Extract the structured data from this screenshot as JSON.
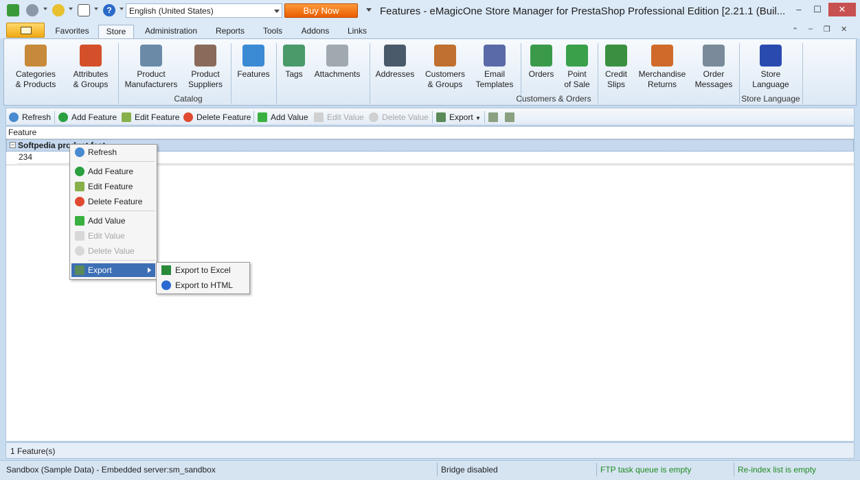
{
  "window": {
    "title": "Features - eMagicOne Store Manager for PrestaShop Professional Edition [2.21.1 (Buil...",
    "language_selected": "English (United States)",
    "buy_now": "Buy Now",
    "minimize": "–",
    "maximize": "☐",
    "close": "✕"
  },
  "tabs": [
    {
      "label": "Favorites"
    },
    {
      "label": "Store"
    },
    {
      "label": "Administration"
    },
    {
      "label": "Reports"
    },
    {
      "label": "Tools"
    },
    {
      "label": "Addons"
    },
    {
      "label": "Links"
    }
  ],
  "ribbon": {
    "catalog": {
      "label": "Catalog",
      "items": [
        {
          "line1": "Categories",
          "line2": "& Products",
          "color": "#c68a3a"
        },
        {
          "line1": "Attributes",
          "line2": "& Groups",
          "color": "#d4502a"
        },
        {
          "line1": "Product",
          "line2": "Manufacturers",
          "color": "#6a8aa8"
        },
        {
          "line1": "Product",
          "line2": "Suppliers",
          "color": "#8a6a5a"
        },
        {
          "line1": "Features",
          "line2": "",
          "color": "#3a8ad4"
        },
        {
          "line1": "Tags",
          "line2": "",
          "color": "#4a9a6a"
        },
        {
          "line1": "Attachments",
          "line2": "",
          "color": "#a0a8b0"
        }
      ]
    },
    "customers_orders": {
      "label": "Customers & Orders",
      "items": [
        {
          "line1": "Addresses",
          "line2": "",
          "color": "#4a5a6a"
        },
        {
          "line1": "Customers",
          "line2": "& Groups",
          "color": "#c07030"
        },
        {
          "line1": "Email",
          "line2": "Templates",
          "color": "#5a6aa8"
        },
        {
          "line1": "Orders",
          "line2": "",
          "color": "#3a9a4a"
        },
        {
          "line1": "Point",
          "line2": "of Sale",
          "color": "#3aa04a"
        },
        {
          "line1": "Credit",
          "line2": "Slips",
          "color": "#3a9040"
        },
        {
          "line1": "Merchandise",
          "line2": "Returns",
          "color": "#d06a2a"
        },
        {
          "line1": "Order",
          "line2": "Messages",
          "color": "#7a8a9a"
        }
      ]
    },
    "store_language": {
      "label": "Store Language",
      "items": [
        {
          "line1": "Store",
          "line2": "Language",
          "color": "#2a4ab0"
        }
      ]
    }
  },
  "toolbar": {
    "refresh": "Refresh",
    "add_feature": "Add Feature",
    "edit_feature": "Edit Feature",
    "delete_feature": "Delete Feature",
    "add_value": "Add Value",
    "edit_value": "Edit Value",
    "delete_value": "Delete Value",
    "export": "Export"
  },
  "grid": {
    "column_header": "Feature",
    "group_label": "Softpedia product feat...",
    "value": "234",
    "count": "1 Feature(s)"
  },
  "context_menu": {
    "refresh": "Refresh",
    "add_feature": "Add Feature",
    "edit_feature": "Edit Feature",
    "delete_feature": "Delete Feature",
    "add_value": "Add Value",
    "edit_value": "Edit Value",
    "delete_value": "Delete Value",
    "export": "Export"
  },
  "submenu": {
    "export_excel": "Export to Excel",
    "export_html": "Export to HTML"
  },
  "statusbar": {
    "connection": "Sandbox (Sample Data) - Embedded server:sm_sandbox",
    "bridge": "Bridge disabled",
    "ftp": "FTP task queue is empty",
    "reindex": "Re-index list is empty"
  }
}
